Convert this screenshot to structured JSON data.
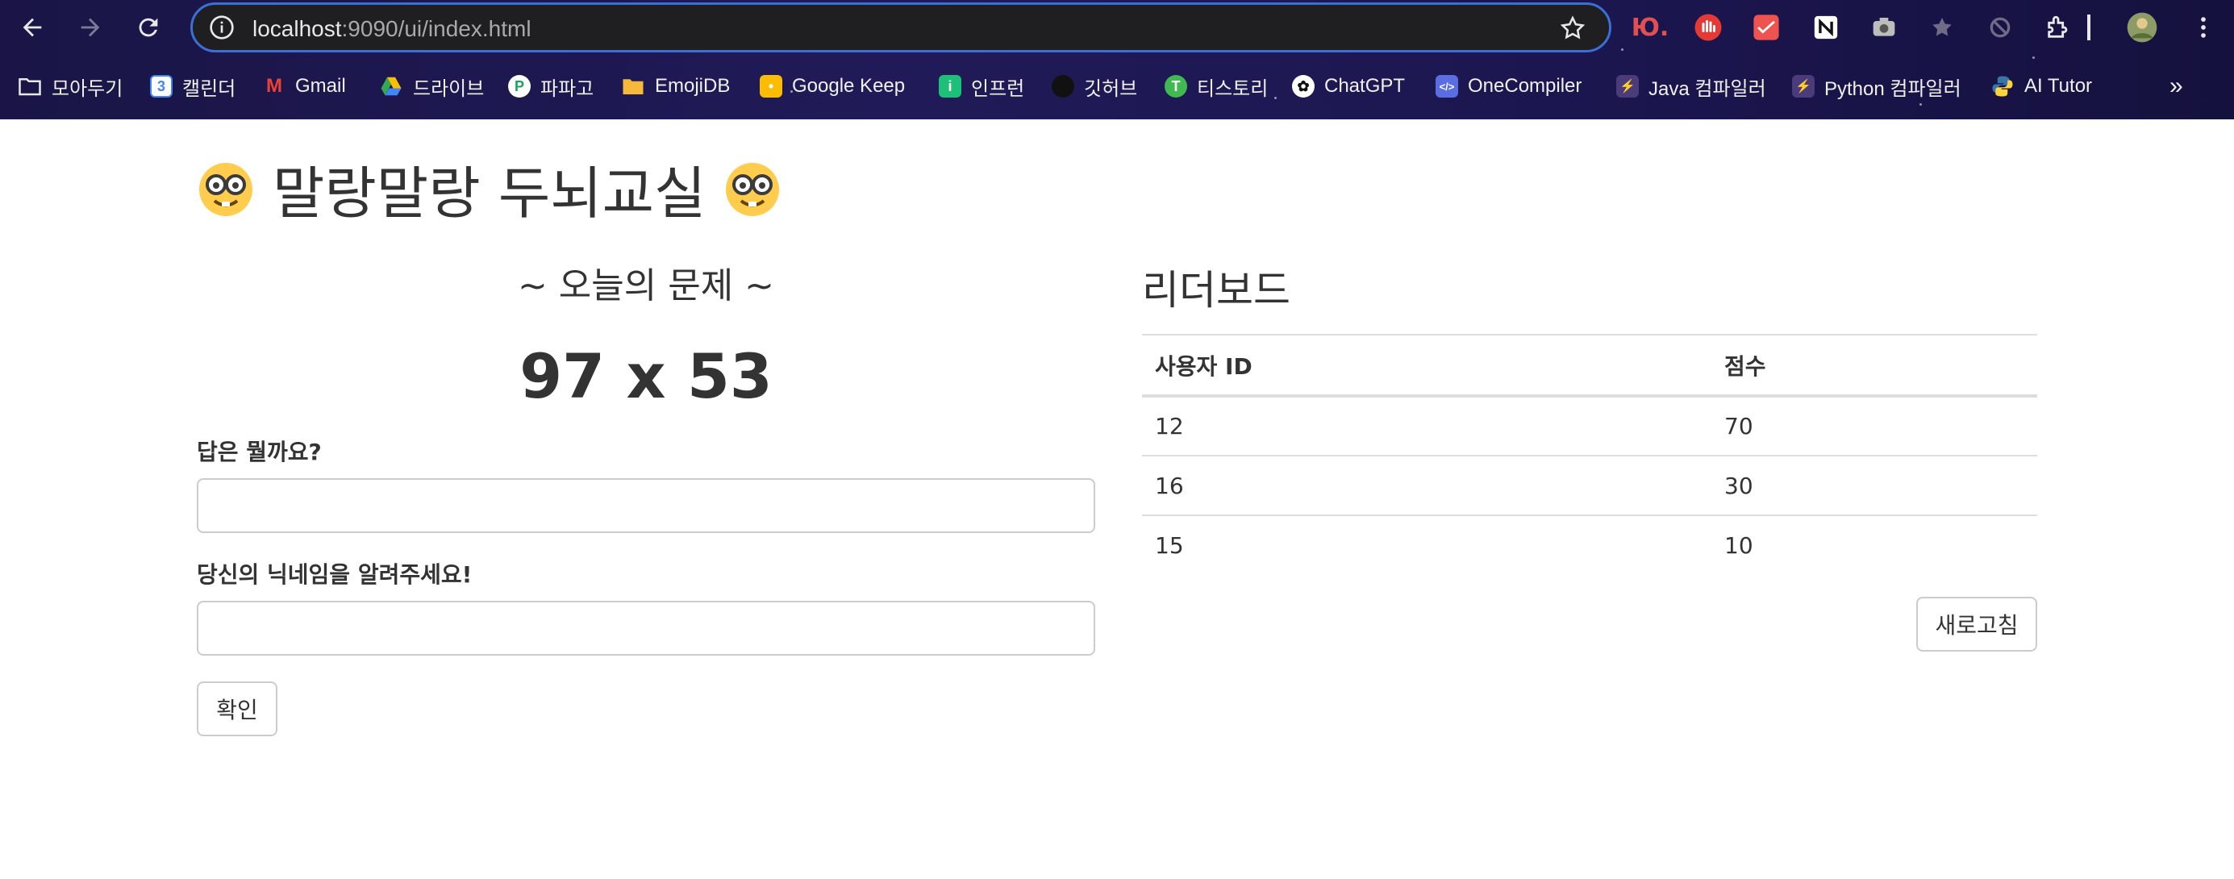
{
  "browser": {
    "url_host": "localhost",
    "url_rest": ":9090/ui/index.html",
    "bookmarks": [
      {
        "label": "모아두기",
        "icon": "folder-icon"
      },
      {
        "label": "캘린더",
        "icon": "calendar-icon",
        "glyph": "3",
        "color": "#4285f4"
      },
      {
        "label": "Gmail",
        "icon": "gmail-icon",
        "glyph": "M",
        "color": "#ea4335"
      },
      {
        "label": "드라이브",
        "icon": "drive-icon",
        "glyph": "▲",
        "color": "#34a853"
      },
      {
        "label": "파파고",
        "icon": "papago-icon",
        "glyph": "P",
        "color": "#1ec800"
      },
      {
        "label": "EmojiDB",
        "icon": "folder-icon"
      },
      {
        "label": "Google Keep",
        "icon": "keep-icon",
        "glyph": "•",
        "color": "#fbbc04"
      },
      {
        "label": "인프런",
        "icon": "inflearn-icon",
        "glyph": "i",
        "color": "#1dc078"
      },
      {
        "label": "깃허브",
        "icon": "github-icon",
        "glyph": "●",
        "color": "#111111"
      },
      {
        "label": "티스토리",
        "icon": "tistory-icon",
        "glyph": "T",
        "color": "#3fb950"
      },
      {
        "label": "ChatGPT",
        "icon": "chatgpt-icon",
        "glyph": "✿",
        "color": "#ffffff"
      },
      {
        "label": "OneCompiler",
        "icon": "onecompiler-icon",
        "glyph": "</>",
        "color": "#5b6ee1"
      },
      {
        "label": "Java 컴파일러",
        "icon": "lightning-icon",
        "glyph": "⚡",
        "color": "#4a3c7a"
      },
      {
        "label": "Python 컴파일러",
        "icon": "lightning-icon",
        "glyph": "⚡",
        "color": "#4a3c7a"
      },
      {
        "label": "AI Tutor",
        "icon": "python-icon",
        "glyph": "🐍",
        "color": "#3776ab"
      }
    ]
  },
  "page": {
    "title": "말랑말랑 두뇌교실",
    "quiz": {
      "heading": "~ 오늘의 문제 ~",
      "question": "97 x 53",
      "answer_label": "답은 뭘까요?",
      "answer_value": "",
      "nickname_label": "당신의 닉네임을 알려주세요!",
      "nickname_value": "",
      "submit_label": "확인"
    },
    "leaderboard": {
      "title": "리더보드",
      "columns": [
        "사용자 ID",
        "점수"
      ],
      "rows": [
        {
          "user_id": "12",
          "score": "70"
        },
        {
          "user_id": "16",
          "score": "30"
        },
        {
          "user_id": "15",
          "score": "10"
        }
      ],
      "refresh_label": "새로고침"
    }
  }
}
